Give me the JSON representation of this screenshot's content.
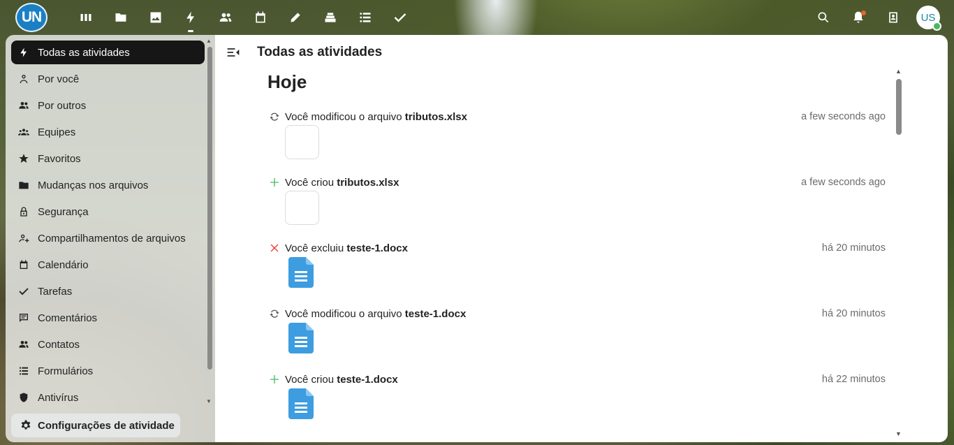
{
  "header": {
    "logo_text": "UN",
    "apps": [
      {
        "name": "dashboard-icon"
      },
      {
        "name": "files-icon"
      },
      {
        "name": "photos-icon"
      },
      {
        "name": "activity-icon"
      },
      {
        "name": "contacts-icon"
      },
      {
        "name": "calendar-icon"
      },
      {
        "name": "notes-icon"
      },
      {
        "name": "deck-icon"
      },
      {
        "name": "tasks-icon"
      },
      {
        "name": "check-icon"
      }
    ],
    "avatar_initials": "US",
    "notification_color": "#e9652b"
  },
  "sidebar": {
    "items": [
      {
        "label": "Todas as atividades",
        "icon": "lightning-icon",
        "active": true
      },
      {
        "label": "Por você",
        "icon": "person-icon"
      },
      {
        "label": "Por outros",
        "icon": "people-icon"
      },
      {
        "label": "Equipes",
        "icon": "group-icon"
      },
      {
        "label": "Favoritos",
        "icon": "star-icon"
      },
      {
        "label": "Mudanças nos arquivos",
        "icon": "folder-icon"
      },
      {
        "label": "Segurança",
        "icon": "lock-icon"
      },
      {
        "label": "Compartilhamentos de arquivos",
        "icon": "share-person-icon"
      },
      {
        "label": "Calendário",
        "icon": "calendar-icon"
      },
      {
        "label": "Tarefas",
        "icon": "check-icon"
      },
      {
        "label": "Comentários",
        "icon": "comment-icon"
      },
      {
        "label": "Contatos",
        "icon": "contacts-icon"
      },
      {
        "label": "Formulários",
        "icon": "list-icon"
      },
      {
        "label": "Antivírus",
        "icon": "shield-icon"
      }
    ],
    "settings_label": "Configurações de atividade"
  },
  "main": {
    "title": "Todas as atividades",
    "section": "Hoje",
    "activities": [
      {
        "type": "modified",
        "prefix": "Você modificou o arquivo ",
        "file": "tributos.xlsx",
        "time": "a few seconds ago",
        "thumb": "blank"
      },
      {
        "type": "created",
        "prefix": "Você criou ",
        "file": "tributos.xlsx",
        "time": "a few seconds ago",
        "thumb": "blank"
      },
      {
        "type": "deleted",
        "prefix": "Você excluiu ",
        "file": "teste-1.docx",
        "time": "há 20 minutos",
        "thumb": "doc"
      },
      {
        "type": "modified",
        "prefix": "Você modificou o arquivo ",
        "file": "teste-1.docx",
        "time": "há 20 minutos",
        "thumb": "doc"
      },
      {
        "type": "created",
        "prefix": "Você criou ",
        "file": "teste-1.docx",
        "time": "há 22 minutos",
        "thumb": "doc"
      }
    ]
  },
  "colors": {
    "accent_dark": "#161616",
    "created": "#46ba61",
    "deleted": "#e9322d",
    "doc_blue": "#3d9de0",
    "logo_blue": "#1b7fc4"
  }
}
